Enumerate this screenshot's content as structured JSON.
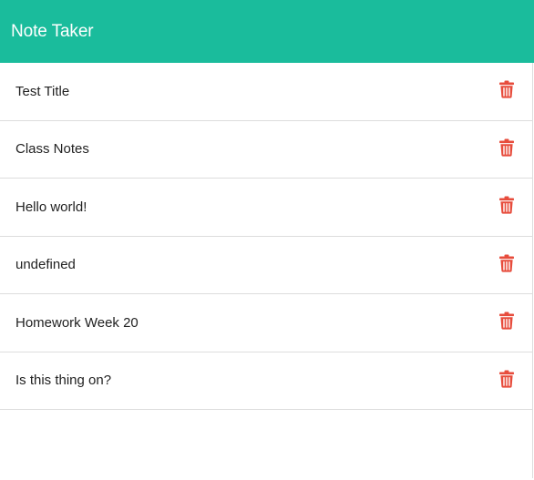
{
  "app": {
    "title": "Note Taker"
  },
  "colors": {
    "navbar": "#1abc9c",
    "delete_icon": "#e74c3c"
  },
  "notes": [
    {
      "title": "Test Title",
      "delete_icon": "trash-icon"
    },
    {
      "title": "Class Notes",
      "delete_icon": "trash-icon"
    },
    {
      "title": "Hello world!",
      "delete_icon": "trash-icon"
    },
    {
      "title": "undefined",
      "delete_icon": "trash-icon"
    },
    {
      "title": "Homework Week 20",
      "delete_icon": "trash-icon"
    },
    {
      "title": "Is this thing on?",
      "delete_icon": "trash-icon"
    }
  ]
}
